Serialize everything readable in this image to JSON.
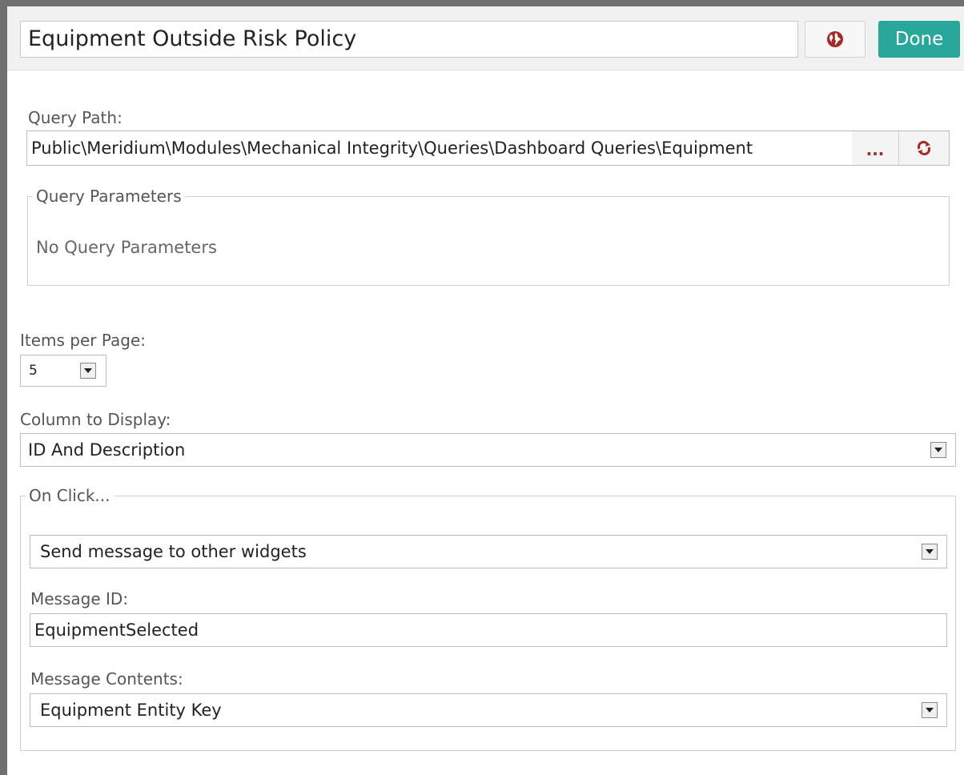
{
  "header": {
    "title_value": "Equipment Outside Risk Policy",
    "globe_icon": "globe-icon",
    "done_label": "Done",
    "accent_color": "#2aa79b"
  },
  "query": {
    "path_label": "Query Path:",
    "path_value": "Public\\Meridium\\Modules\\Mechanical Integrity\\Queries\\Dashboard Queries\\Equipment",
    "browse_label": "...",
    "refresh_icon": "refresh-icon",
    "parameters_legend": "Query Parameters",
    "parameters_empty": "No Query Parameters"
  },
  "items_per_page": {
    "label": "Items per Page:",
    "value": "5"
  },
  "column_to_display": {
    "label": "Column to Display:",
    "value": "ID And Description"
  },
  "on_click": {
    "legend": "On Click...",
    "action_value": "Send message to other widgets",
    "message_id_label": "Message ID:",
    "message_id_value": "EquipmentSelected",
    "message_contents_label": "Message Contents:",
    "message_contents_value": "Equipment Entity Key"
  }
}
